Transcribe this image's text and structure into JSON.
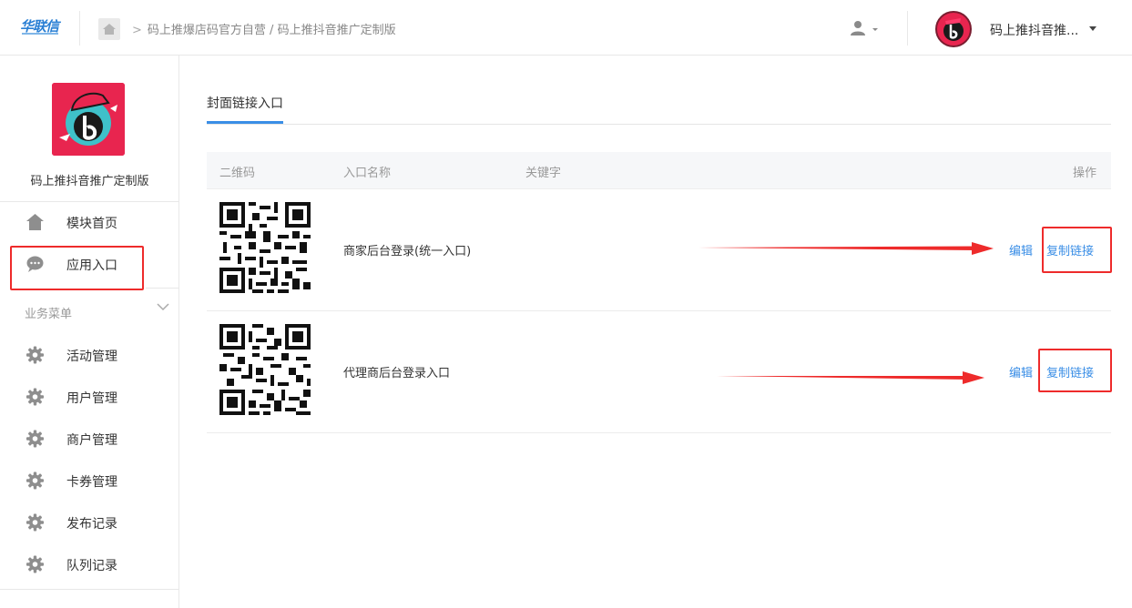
{
  "header": {
    "logo_text": "华联信",
    "breadcrumb": [
      "码上推爆店码官方自营",
      "码上推抖音推广定制版"
    ],
    "account_name": "码上推抖音推..."
  },
  "sidebar": {
    "app_name": "码上推抖音推广定制版",
    "top_items": [
      {
        "label": "模块首页",
        "icon": "home-icon"
      },
      {
        "label": "应用入口",
        "icon": "chat-bubble-icon"
      }
    ],
    "section_title": "业务菜单",
    "menu_items": [
      {
        "label": "活动管理",
        "icon": "gear-icon"
      },
      {
        "label": "用户管理",
        "icon": "gear-icon"
      },
      {
        "label": "商户管理",
        "icon": "gear-icon"
      },
      {
        "label": "卡券管理",
        "icon": "gear-icon"
      },
      {
        "label": "发布记录",
        "icon": "gear-icon"
      },
      {
        "label": "队列记录",
        "icon": "gear-icon"
      }
    ]
  },
  "main": {
    "tab_label": "封面链接入口",
    "columns": {
      "qr": "二维码",
      "name": "入口名称",
      "keyword": "关键字",
      "action": "操作"
    },
    "rows": [
      {
        "name": "商家后台登录(统一入口)",
        "keyword": "",
        "edit": "编辑",
        "copy": "复制链接"
      },
      {
        "name": "代理商后台登录入口",
        "keyword": "",
        "edit": "编辑",
        "copy": "复制链接"
      }
    ]
  },
  "colors": {
    "accent": "#3a8ee6",
    "annotation_red": "#ee2b2b",
    "brand_pink": "#e8254f"
  }
}
